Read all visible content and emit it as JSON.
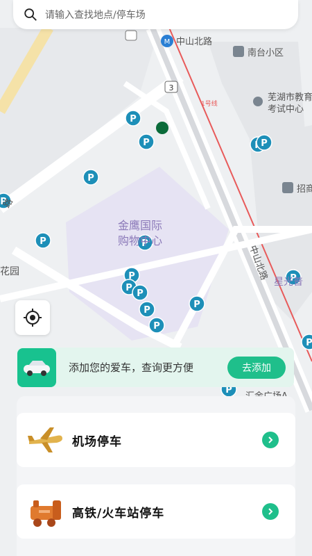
{
  "search": {
    "placeholder": "请输入查找地点/停车场"
  },
  "map": {
    "labels": {
      "zhongshan_north_road_top": "中山北路",
      "nantai": "南台小区",
      "wuhu_edu_1": "芜湖市教育",
      "wuhu_edu_2": "考试中心",
      "zhao": "招商",
      "mall_1": "金鹰国际",
      "mall_2": "购物中心",
      "zhongshan_vertical": "中山北路",
      "star": "星光普",
      "huajin": "汇金广场A",
      "garden": "花园",
      "road_left": "路",
      "line1": "1号线",
      "route3": "3"
    }
  },
  "banner": {
    "text": "添加您的爱车，查询更方便",
    "button": "去添加"
  },
  "cards": [
    {
      "label": "机场停车",
      "icon": "airplane-icon"
    },
    {
      "label": "高铁/火车站停车",
      "icon": "train-icon"
    }
  ],
  "colors": {
    "accent": "#1fbf8b",
    "parking_pin": "#1d8fb8",
    "metro_line": "#e85a5a"
  }
}
